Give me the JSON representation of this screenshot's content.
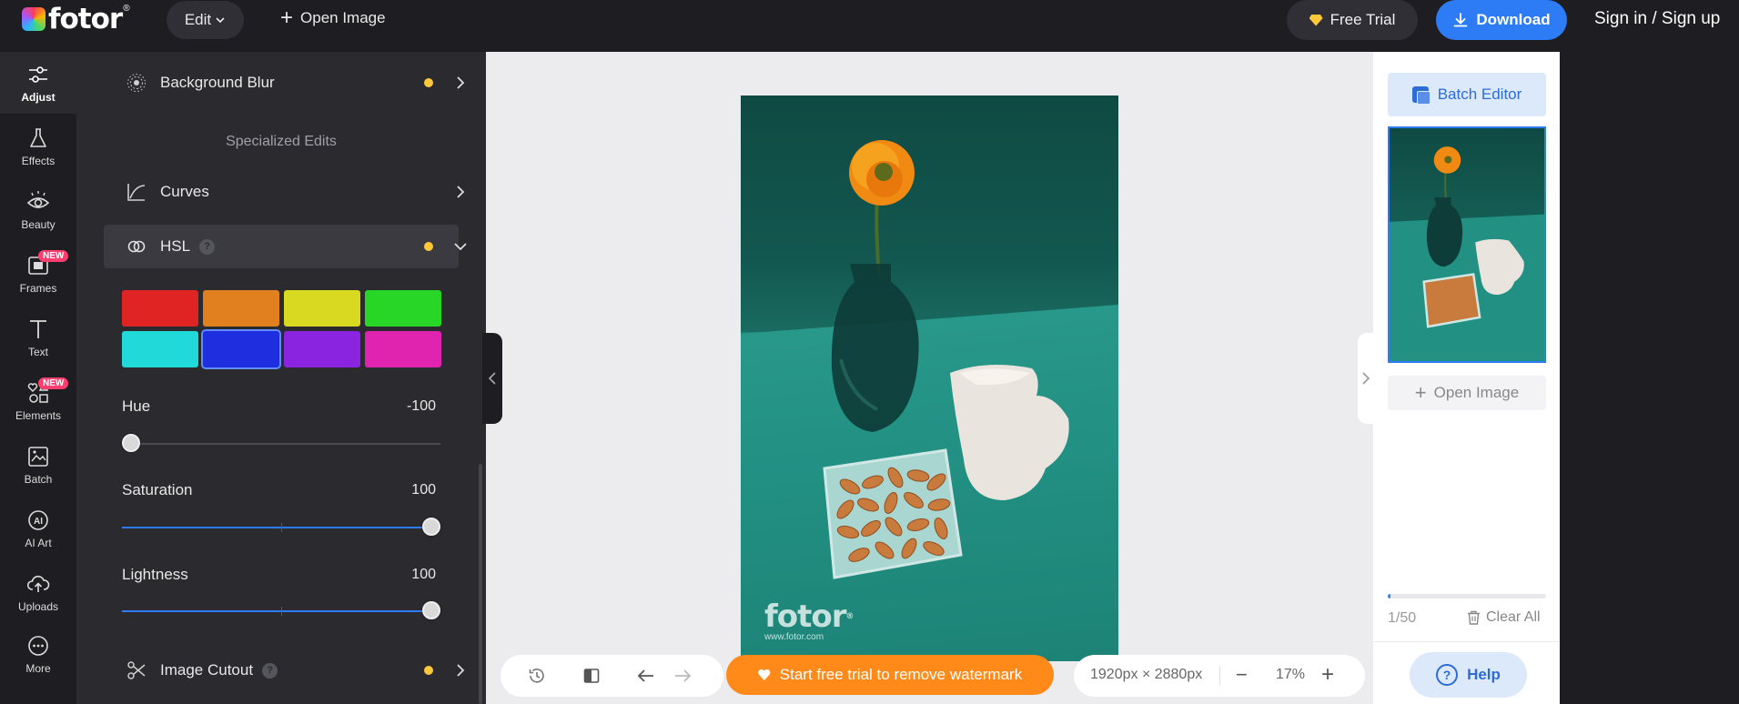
{
  "topbar": {
    "logo_text": "fotor",
    "logo_reg": "®",
    "edit_label": "Edit",
    "open_image_label": "Open Image",
    "free_trial_label": "Free Trial",
    "download_label": "Download",
    "signin_label": "Sign in / Sign up"
  },
  "rail": {
    "items": [
      {
        "label": "Adjust",
        "icon": "adjust-sliders-icon",
        "active": true
      },
      {
        "label": "Effects",
        "icon": "flask-icon"
      },
      {
        "label": "Beauty",
        "icon": "eye-icon"
      },
      {
        "label": "Frames",
        "icon": "frame-icon",
        "badge": "NEW"
      },
      {
        "label": "Text",
        "icon": "text-t-icon"
      },
      {
        "label": "Elements",
        "icon": "shapes-icon",
        "badge": "NEW"
      },
      {
        "label": "Batch",
        "icon": "batch-images-icon"
      },
      {
        "label": "AI Art",
        "icon": "ai-circle-icon"
      },
      {
        "label": "Uploads",
        "icon": "cloud-upload-icon"
      },
      {
        "label": "More",
        "icon": "more-dots-icon"
      }
    ]
  },
  "panel": {
    "background_blur_label": "Background Blur",
    "specialized_edits_title": "Specialized Edits",
    "curves_label": "Curves",
    "hsl_label": "HSL",
    "help_mark": "?",
    "colors": [
      "#e02424",
      "#e0801f",
      "#d9d922",
      "#27d627",
      "#22d9d9",
      "#1f2fe0",
      "#8a24e0",
      "#e024b0"
    ],
    "selected_color_index": 5,
    "hue": {
      "label": "Hue",
      "value": "-100",
      "fraction": 0.0
    },
    "saturation": {
      "label": "Saturation",
      "value": "100",
      "fraction": 1.0
    },
    "lightness": {
      "label": "Lightness",
      "value": "100",
      "fraction": 1.0
    },
    "image_cutout_label": "Image Cutout"
  },
  "canvas": {
    "watermark_logo": "fotor",
    "watermark_reg": "®",
    "watermark_url": "www.fotor.com",
    "remove_watermark_label": "Start free trial to remove watermark",
    "dimensions": "1920px × 2880px",
    "zoom": "17%"
  },
  "batch": {
    "batch_editor_label": "Batch Editor",
    "open_image_label": "Open Image",
    "count": "1/50",
    "progress_fraction": 0.02,
    "clear_all_label": "Clear All",
    "help_label": "Help"
  },
  "colors": {
    "accent": "#2d7cf6",
    "watermark_button": "#ff8a1a",
    "dot": "#ffc83a",
    "new_badge": "#ff3d6e"
  }
}
